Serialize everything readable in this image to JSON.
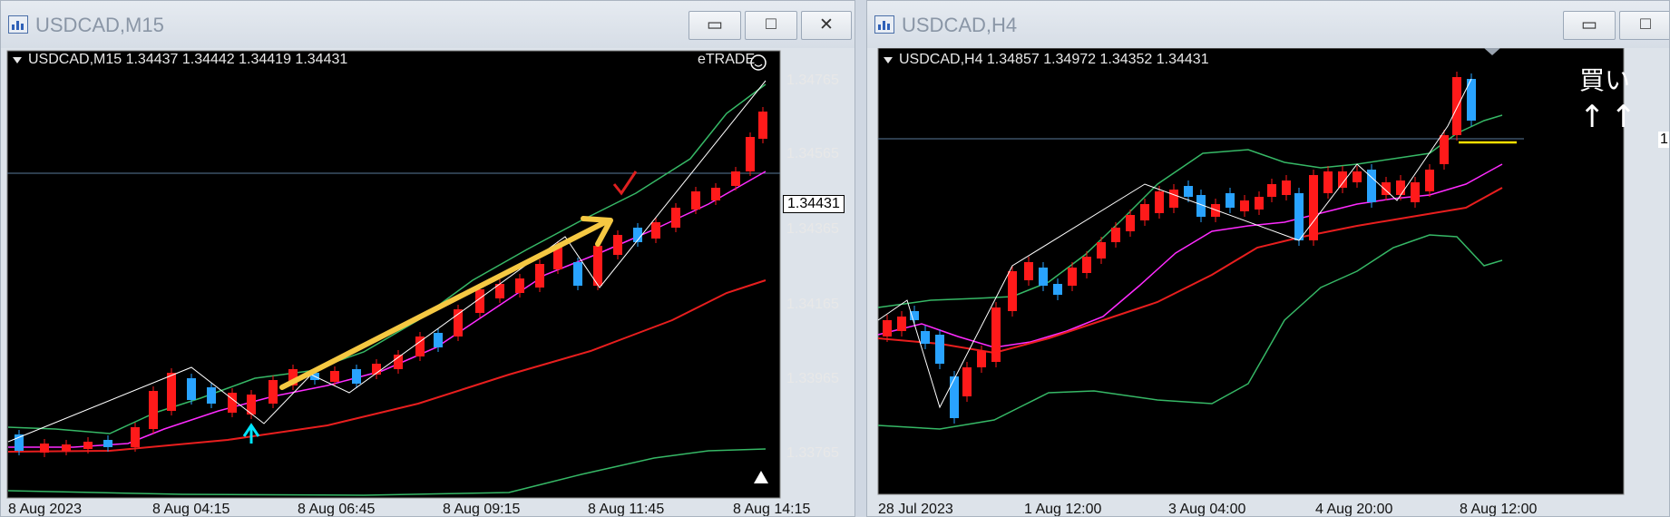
{
  "window1": {
    "title": "USDCAD,M15",
    "ohlc": "USDCAD,M15  1.34437 1.34442 1.34419 1.34431",
    "broker": "eTRADE",
    "prices": [
      "1.34765",
      "1.34565",
      "1.34365",
      "1.34165",
      "1.33965",
      "1.33765"
    ],
    "current_price": "1.34431",
    "times": [
      "8 Aug 2023",
      "8 Aug 04:15",
      "8 Aug 06:45",
      "8 Aug 09:15",
      "8 Aug 11:45",
      "8 Aug 14:15"
    ],
    "buttons": {
      "minimize": "▭",
      "maximize": "□",
      "close": "✕"
    }
  },
  "window2": {
    "title": "USDCAD,H4",
    "ohlc": "USDCAD,H4  1.34857 1.34972 1.34352 1.34431",
    "annotation_line1": "買い",
    "annotation_line2": "↑↑",
    "price_marker": "1",
    "times": [
      "28 Jul 2023",
      "1 Aug 12:00",
      "3 Aug 04:00",
      "4 Aug 20:00",
      "8 Aug 12:00"
    ],
    "buttons": {
      "minimize": "▭",
      "maximize": "□"
    }
  },
  "colors": {
    "bull": "#ff1a1a",
    "bear": "#29a3ff",
    "band": "#36b866",
    "ma_fast": "#ff2bff",
    "ma_slow": "#e81e1e",
    "arrow": "#f5c842",
    "cyan": "#00e5ff"
  }
}
